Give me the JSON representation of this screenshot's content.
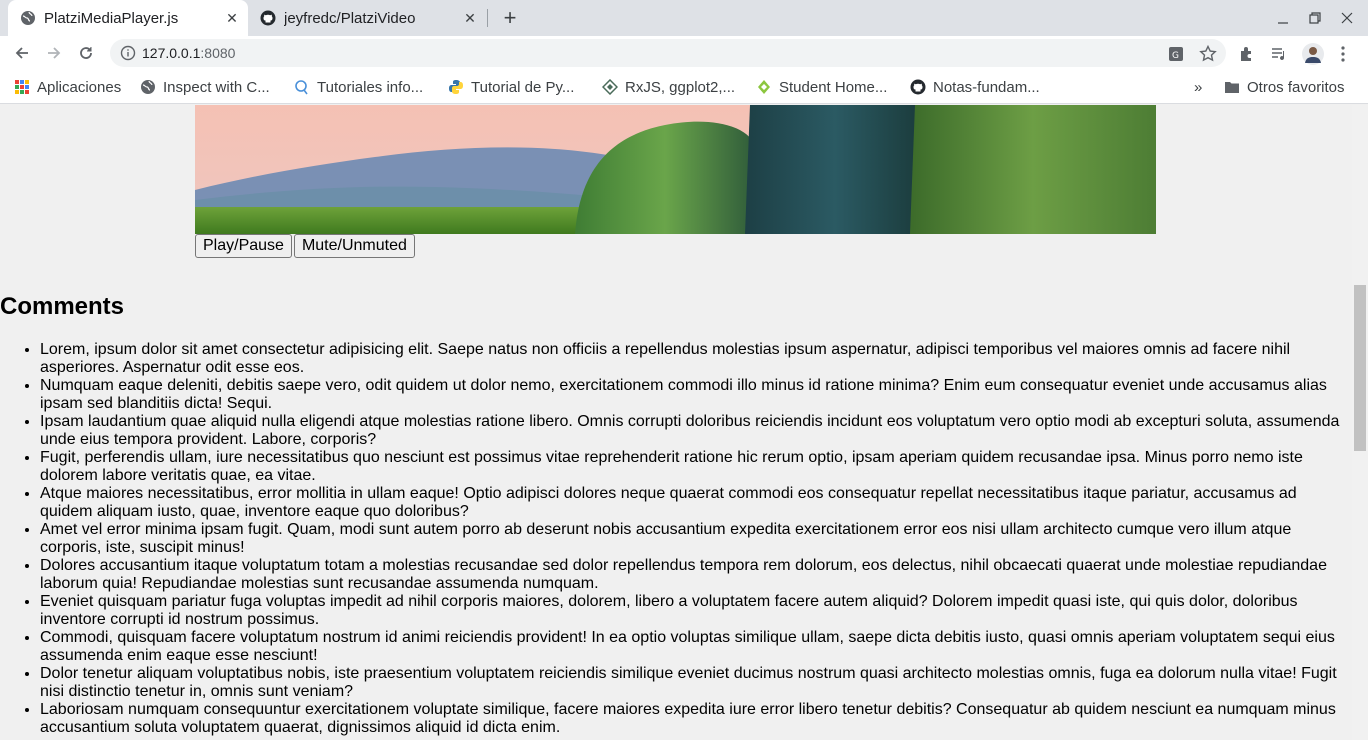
{
  "browser": {
    "tabs": [
      {
        "title": "PlatziMediaPlayer.js",
        "active": true
      },
      {
        "title": "jeyfredc/PlatziVideo",
        "active": false
      }
    ],
    "url_host": "127.0.0.1",
    "url_port": ":8080",
    "bookmarks": [
      {
        "label": "Aplicaciones",
        "icon": "apps-grid-icon"
      },
      {
        "label": "Inspect with C...",
        "icon": "globe-icon"
      },
      {
        "label": "Tutoriales info...",
        "icon": "search-bubble-icon"
      },
      {
        "label": "Tutorial de Py...",
        "icon": "python-icon"
      },
      {
        "label": "RxJS, ggplot2,...",
        "icon": "diamond-icon"
      },
      {
        "label": "Student Home...",
        "icon": "student-icon"
      },
      {
        "label": "Notas-fundam...",
        "icon": "github-icon"
      }
    ],
    "more_bookmarks": "»",
    "other_bookmarks": "Otros favoritos"
  },
  "player": {
    "play_label": "Play/Pause",
    "mute_label": "Mute/Unmuted"
  },
  "comments": {
    "title": "Comments",
    "items": [
      "Lorem, ipsum dolor sit amet consectetur adipisicing elit. Saepe natus non officiis a repellendus molestias ipsum aspernatur, adipisci temporibus vel maiores omnis ad facere nihil asperiores. Aspernatur odit esse eos.",
      "Numquam eaque deleniti, debitis saepe vero, odit quidem ut dolor nemo, exercitationem commodi illo minus id ratione minima? Enim eum consequatur eveniet unde accusamus alias ipsam sed blanditiis dicta! Sequi.",
      "Ipsam laudantium quae aliquid nulla eligendi atque molestias ratione libero. Omnis corrupti doloribus reiciendis incidunt eos voluptatum vero optio modi ab excepturi soluta, assumenda unde eius tempora provident. Labore, corporis?",
      "Fugit, perferendis ullam, iure necessitatibus quo nesciunt est possimus vitae reprehenderit ratione hic rerum optio, ipsam aperiam quidem recusandae ipsa. Minus porro nemo iste dolorem labore veritatis quae, ea vitae.",
      "Atque maiores necessitatibus, error mollitia in ullam eaque! Optio adipisci dolores neque quaerat commodi eos consequatur repellat necessitatibus itaque pariatur, accusamus ad quidem aliquam iusto, quae, inventore eaque quo doloribus?",
      "Amet vel error minima ipsam fugit. Quam, modi sunt autem porro ab deserunt nobis accusantium expedita exercitationem error eos nisi ullam architecto cumque vero illum atque corporis, iste, suscipit minus!",
      "Dolores accusantium itaque voluptatum totam a molestias recusandae sed dolor repellendus tempora rem dolorum, eos delectus, nihil obcaecati quaerat unde molestiae repudiandae laborum quia! Repudiandae molestias sunt recusandae assumenda numquam.",
      "Eveniet quisquam pariatur fuga voluptas impedit ad nihil corporis maiores, dolorem, libero a voluptatem facere autem aliquid? Dolorem impedit quasi iste, qui quis dolor, doloribus inventore corrupti id nostrum possimus.",
      "Commodi, quisquam facere voluptatum nostrum id animi reiciendis provident! In ea optio voluptas similique ullam, saepe dicta debitis iusto, quasi omnis aperiam voluptatem sequi eius assumenda enim eaque esse nesciunt!",
      "Dolor tenetur aliquam voluptatibus nobis, iste praesentium voluptatem reiciendis similique eveniet ducimus nostrum quasi architecto molestias omnis, fuga ea dolorum nulla vitae! Fugit nisi distinctio tenetur in, omnis sunt veniam?",
      "Laboriosam numquam consequuntur exercitationem voluptate similique, facere maiores expedita iure error libero tenetur debitis? Consequatur ab quidem nesciunt ea numquam minus accusantium soluta voluptatem quaerat, dignissimos aliquid id dicta enim."
    ]
  }
}
